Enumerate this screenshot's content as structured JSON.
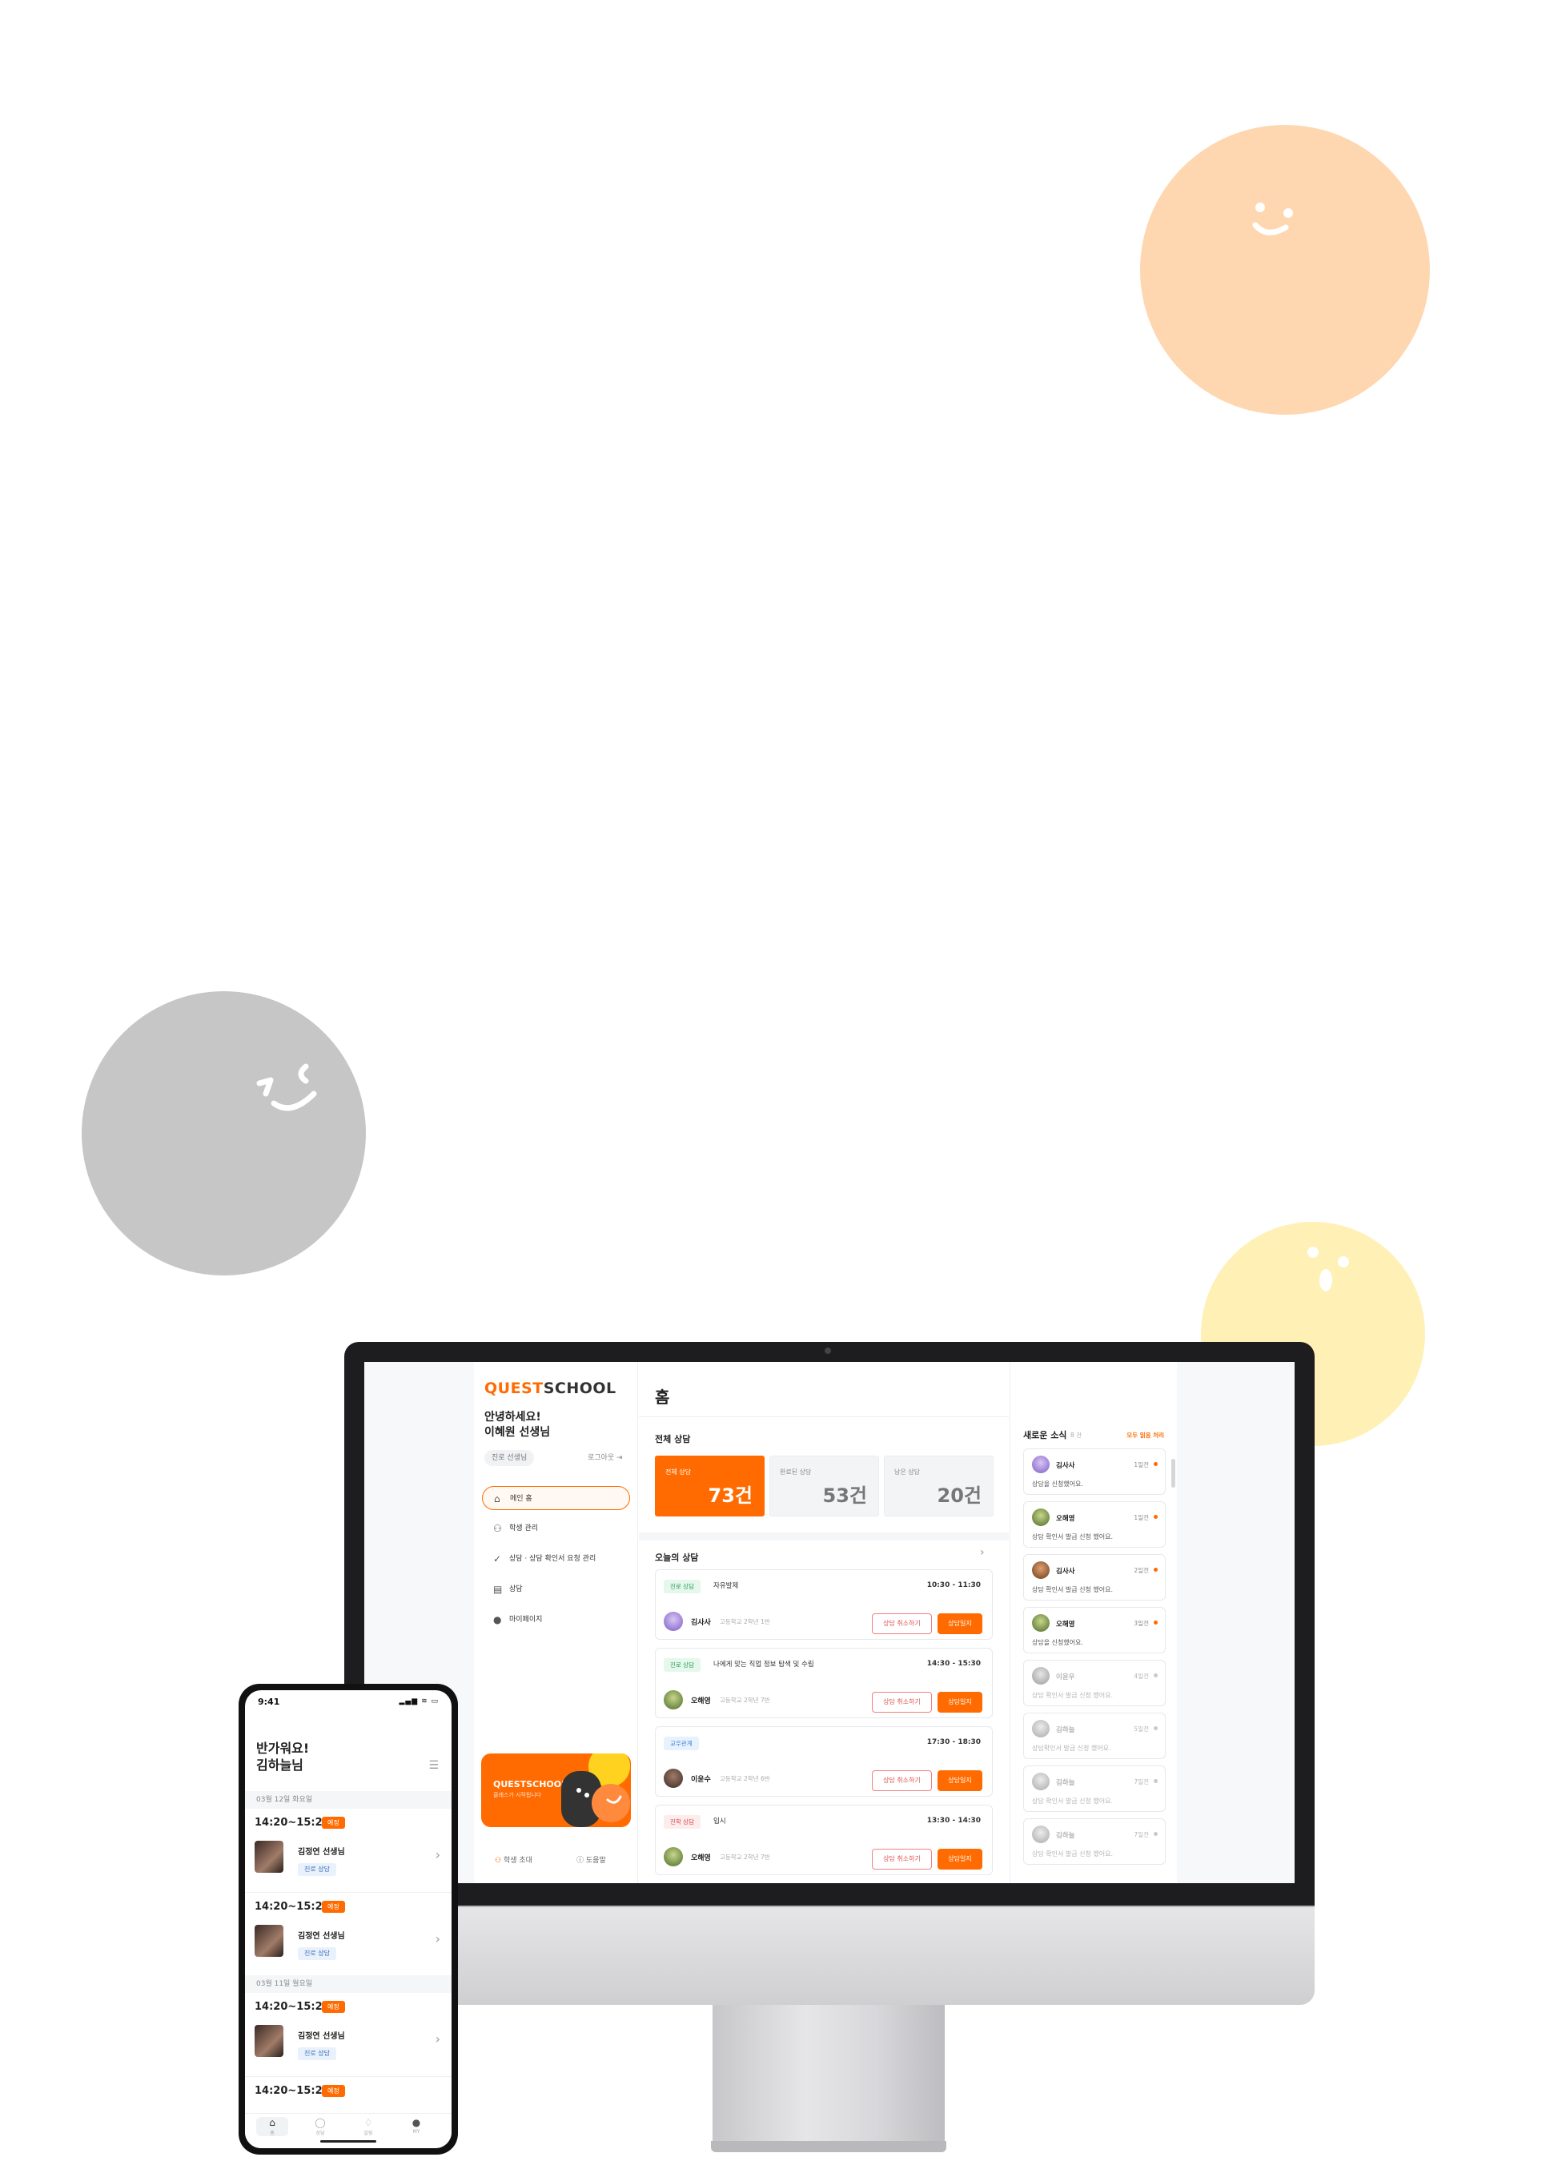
{
  "colors": {
    "accent": "#ff6b00",
    "blob_orange": "#fed7b0",
    "blob_gray": "#c6c6c6",
    "blob_yellow": "#fff0b5"
  },
  "sidebar": {
    "logo_quest": "QUEST",
    "logo_school": "SCHOOL",
    "greeting_line1": "안녕하세요!",
    "greeting_line2": "이혜원 선생님",
    "role": "진로 선생님",
    "logout": "로그아웃",
    "nav": [
      {
        "label": "메인 홈",
        "icon": "home-icon"
      },
      {
        "label": "학생 관리",
        "icon": "users-icon"
      },
      {
        "label": "상담 · 상담 확인서 요청 관리",
        "icon": "check-icon"
      },
      {
        "label": "상담",
        "icon": "calendar-icon"
      },
      {
        "label": "마이페이지",
        "icon": "profile-dot-icon"
      }
    ],
    "promo_title": "QUESTSCHOOL",
    "promo_sub": "클래스가 시작됩니다",
    "footer_invite": "학생 초대",
    "footer_help": "도움말"
  },
  "main": {
    "title": "홈",
    "stats_title": "전체 상담",
    "stats": [
      {
        "label": "전체 상담",
        "value": "73건"
      },
      {
        "label": "완료된 상담",
        "value": "53건"
      },
      {
        "label": "남은 상담",
        "value": "20건"
      }
    ],
    "today_title": "오늘의 상담",
    "cards": [
      {
        "tag": "진로 상담",
        "tag_color": "g",
        "title": "자유발제",
        "time": "10:30 - 11:30",
        "name": "김사사",
        "grade": "고등학교 2학년 1반",
        "btn_cancel": "상담 취소하기",
        "btn_start": "상담일지"
      },
      {
        "tag": "진로 상담",
        "tag_color": "g",
        "title": "나에게 맞는 직업 정보 탐색 및 수립",
        "time": "14:30 - 15:30",
        "name": "오해영",
        "grade": "고등학교 2학년 7반",
        "btn_cancel": "상담 취소하기",
        "btn_start": "상담일지"
      },
      {
        "tag": "교우관계",
        "tag_color": "b",
        "title": "",
        "time": "17:30 - 18:30",
        "name": "이윤수",
        "grade": "고등학교 2학년 6반",
        "btn_cancel": "상담 취소하기",
        "btn_start": "상담일지"
      },
      {
        "tag": "진학 상담",
        "tag_color": "r",
        "title": "입시",
        "time": "13:30 - 14:30",
        "name": "오해영",
        "grade": "고등학교 2학년 7반",
        "btn_cancel": "상담 취소하기",
        "btn_start": "상담일지"
      }
    ]
  },
  "news": {
    "title": "새로운 소식",
    "count": "8 건",
    "all": "모두 읽음 처리",
    "items": [
      {
        "name": "김사사",
        "time": "1일전",
        "msg": "상담을 신청했어요.",
        "dim": false
      },
      {
        "name": "오해영",
        "time": "1일전",
        "msg": "상담 확인서 발급 신청 했어요.",
        "dim": false
      },
      {
        "name": "김사사",
        "time": "2일전",
        "msg": "상담 확인서 발급 신청 했어요.",
        "dim": false
      },
      {
        "name": "오해영",
        "time": "3일전",
        "msg": "상담을 신청했어요.",
        "dim": false
      },
      {
        "name": "이윤우",
        "time": "4일전",
        "msg": "상담 확인서 발급 신청 했어요.",
        "dim": true
      },
      {
        "name": "김하늘",
        "time": "5일전",
        "msg": "상담확인서 발급 신청 했어요.",
        "dim": true
      },
      {
        "name": "김하늘",
        "time": "7일전",
        "msg": "상담 확인서 발급 신청 했어요.",
        "dim": true
      },
      {
        "name": "김하늘",
        "time": "7일전",
        "msg": "상담 확인서 발급 신청 했어요.",
        "dim": true
      }
    ]
  },
  "phone": {
    "time": "9:41",
    "status": "▂▄▆ ≋ ▭",
    "greeting_line1": "반가워요!",
    "greeting_line2": "김하늘님",
    "dates": [
      "03월 12일 화요일",
      "03월 11일 월요일"
    ],
    "items": [
      {
        "time": "14:20~15:20",
        "badge": "예정",
        "teacher": "김정연 선생님",
        "type": "진로 상담"
      },
      {
        "time": "14:20~15:20",
        "badge": "예정",
        "teacher": "김정연 선생님",
        "type": "진로 상담"
      },
      {
        "time": "14:20~15:20",
        "badge": "예정",
        "teacher": "김정연 선생님",
        "type": "진로 상담"
      },
      {
        "time": "14:20~15:20",
        "badge": "예정",
        "teacher": "",
        "type": ""
      }
    ],
    "tabs": [
      {
        "label": "홈",
        "icon": "home-icon"
      },
      {
        "label": "상담",
        "icon": "chat-icon"
      },
      {
        "label": "알림",
        "icon": "bell-icon"
      },
      {
        "label": "MY",
        "icon": "profile-icon"
      }
    ]
  }
}
